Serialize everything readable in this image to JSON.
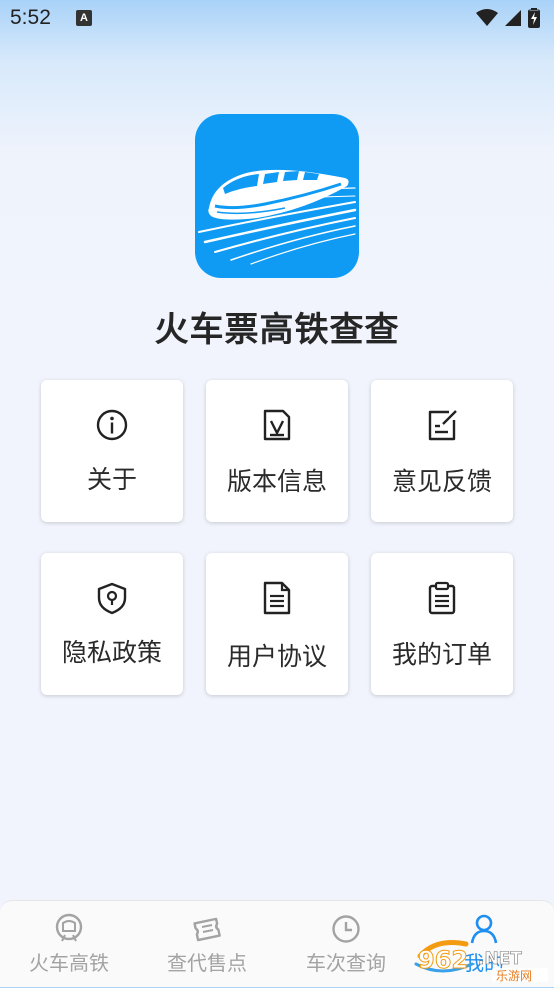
{
  "status_bar": {
    "time": "5:52",
    "notification": "A"
  },
  "app": {
    "name": "火车票高铁查查"
  },
  "menu": [
    {
      "label": "关于",
      "icon": "info-icon"
    },
    {
      "label": "版本信息",
      "icon": "version-doc-icon"
    },
    {
      "label": "意见反馈",
      "icon": "feedback-edit-icon"
    },
    {
      "label": "隐私政策",
      "icon": "privacy-shield-icon"
    },
    {
      "label": "用户协议",
      "icon": "agreement-doc-icon"
    },
    {
      "label": "我的订单",
      "icon": "orders-clipboard-icon"
    }
  ],
  "bottom_nav": [
    {
      "label": "火车高铁",
      "icon": "train-icon",
      "active": false
    },
    {
      "label": "查代售点",
      "icon": "ticket-icon",
      "active": false
    },
    {
      "label": "车次查询",
      "icon": "clock-icon",
      "active": false
    },
    {
      "label": "我的",
      "icon": "user-icon",
      "active": true
    }
  ],
  "colors": {
    "brand": "#0f9bf4",
    "active_nav": "#1e8ff0",
    "inactive_nav": "#a3a3a3"
  },
  "watermark": {
    "text": "962.NET",
    "sub": "乐游网"
  }
}
